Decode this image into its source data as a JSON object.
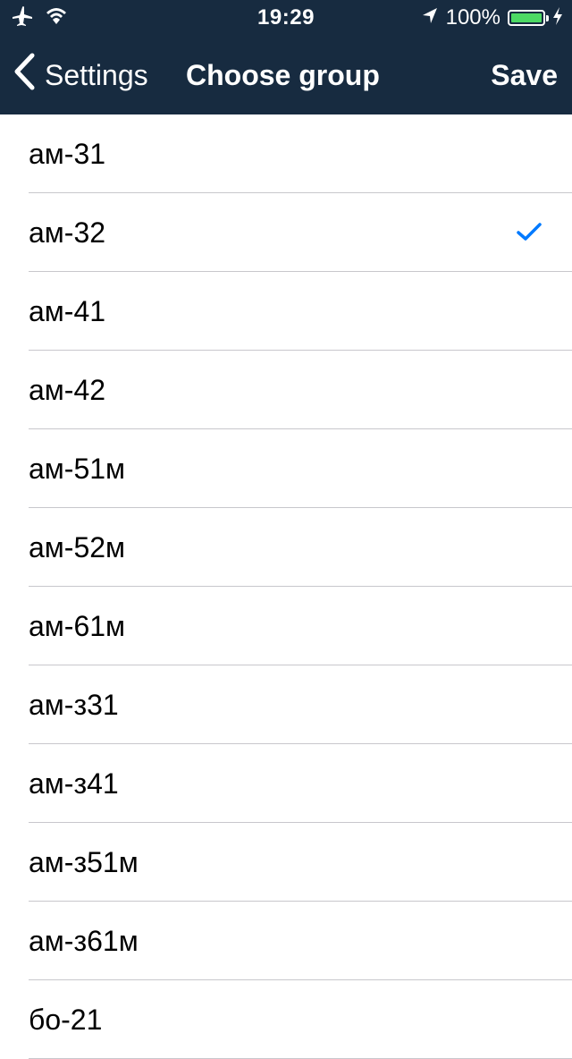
{
  "status_bar": {
    "time": "19:29",
    "battery_percent_text": "100%",
    "battery_level": 1.0,
    "icons": [
      "airplane-mode-icon",
      "wifi-icon",
      "location-arrow-icon",
      "battery-icon",
      "charging-bolt-icon"
    ],
    "battery_color": "#4cd964"
  },
  "nav": {
    "back_label": "Settings",
    "title": "Choose group",
    "save_label": "Save",
    "background_color": "#172b40"
  },
  "groups": {
    "selected_index": 1,
    "check_color": "#007aff",
    "items": [
      {
        "label": "ам-31"
      },
      {
        "label": "ам-32"
      },
      {
        "label": "ам-41"
      },
      {
        "label": "ам-42"
      },
      {
        "label": "ам-51м"
      },
      {
        "label": "ам-52м"
      },
      {
        "label": "ам-61м"
      },
      {
        "label": "ам-з31"
      },
      {
        "label": "ам-з41"
      },
      {
        "label": "ам-з51м"
      },
      {
        "label": "ам-з61м"
      },
      {
        "label": "бо-21"
      }
    ]
  }
}
